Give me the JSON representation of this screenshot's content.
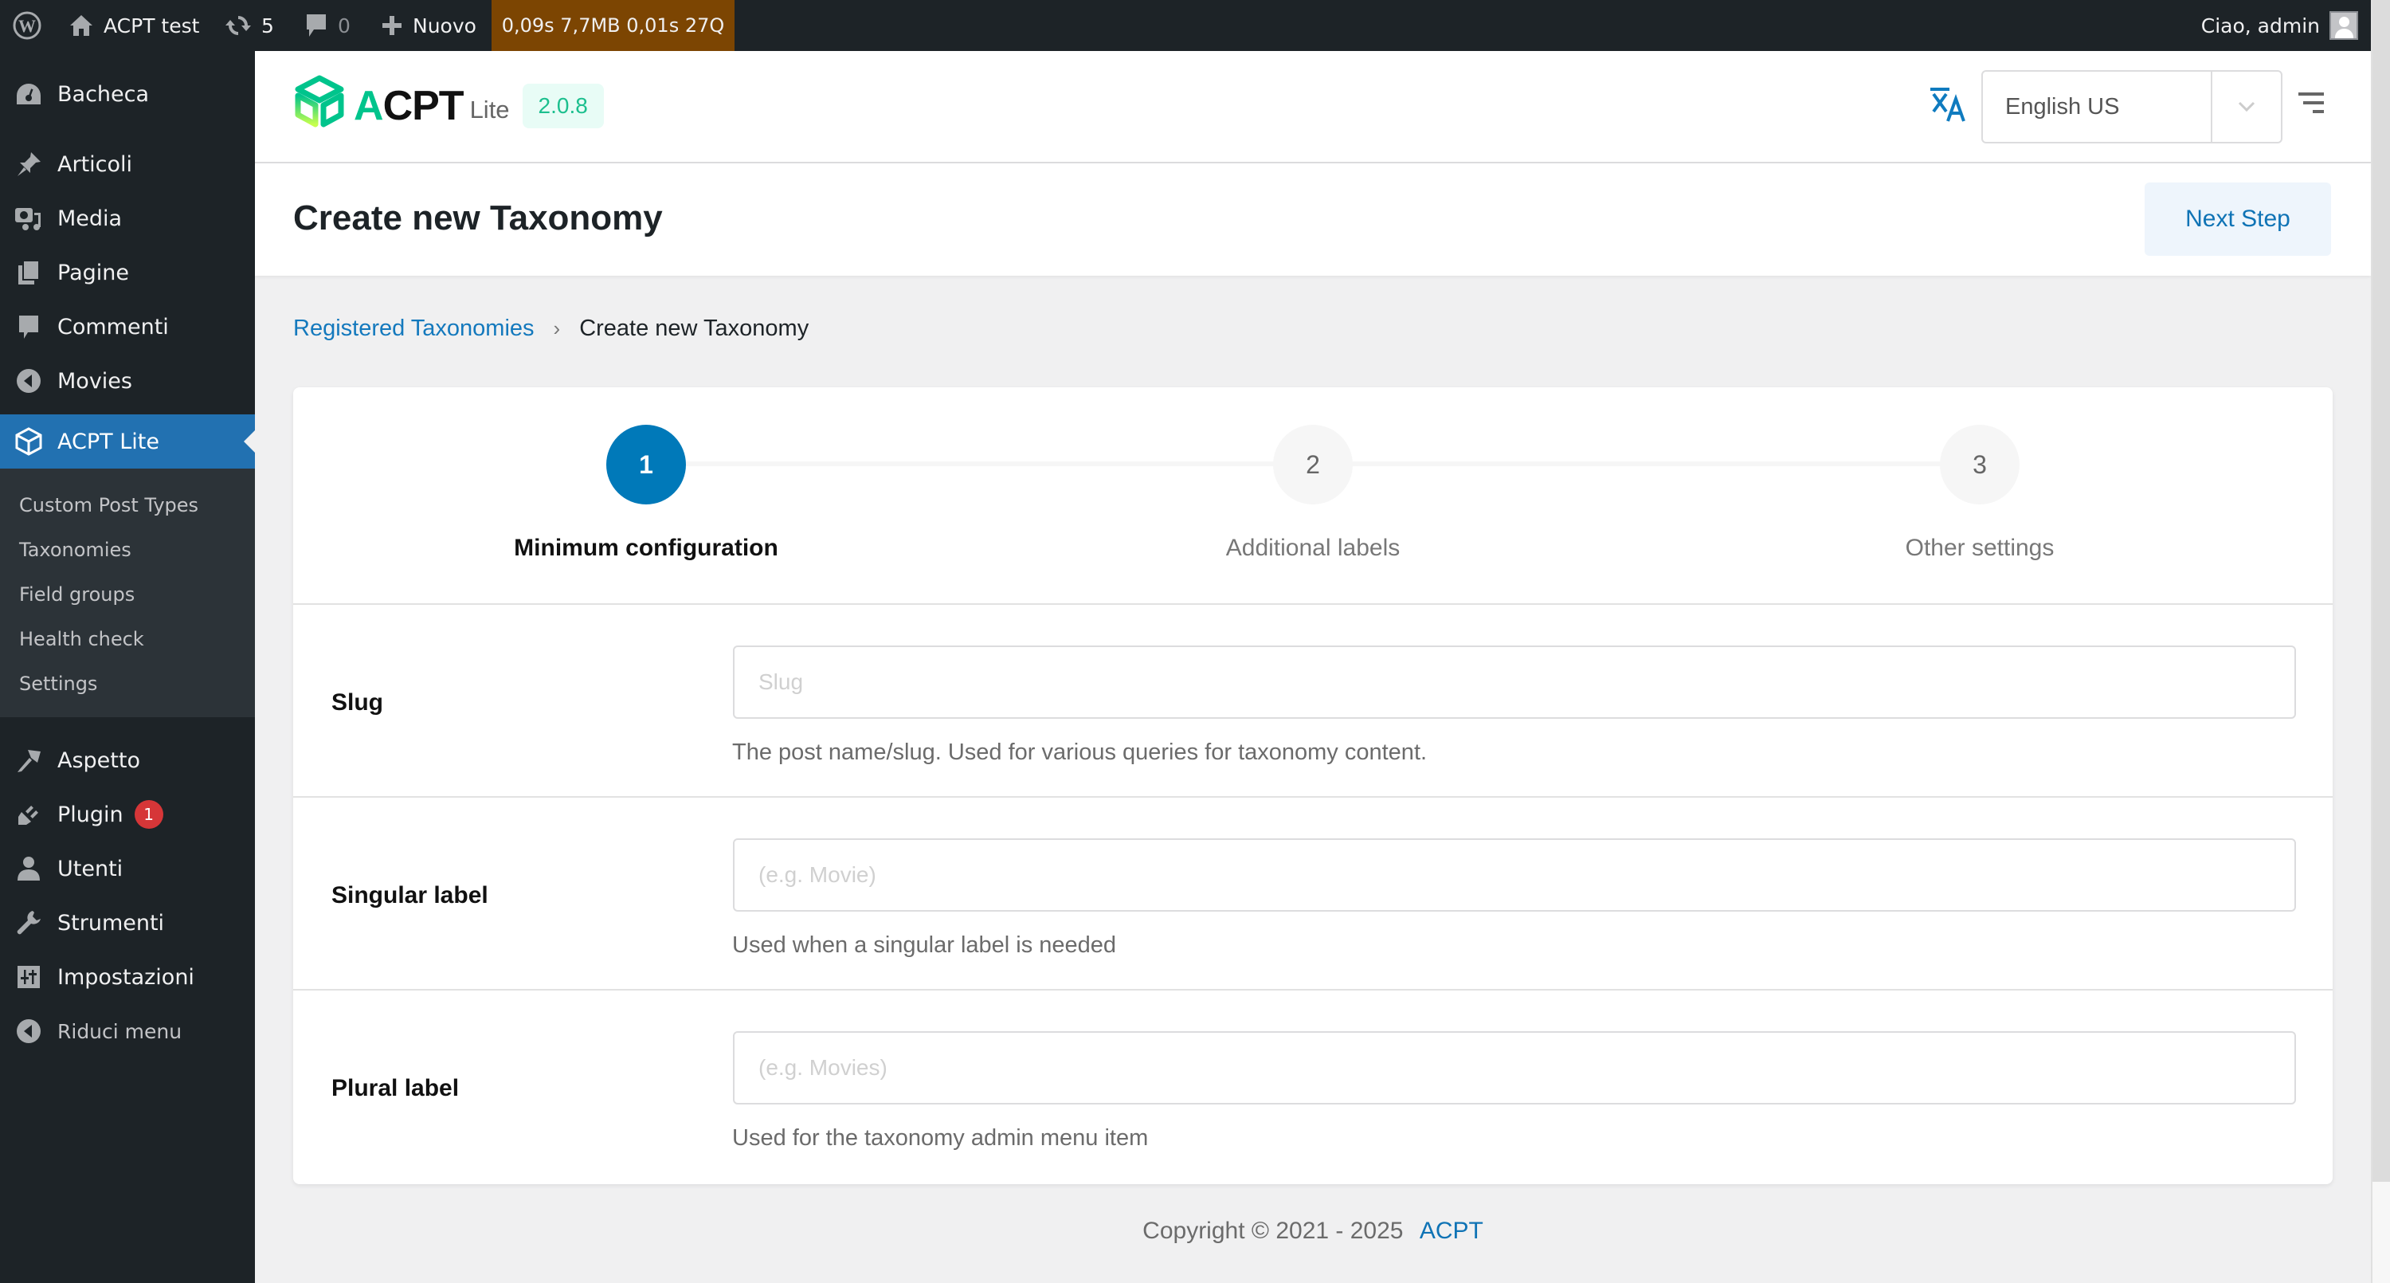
{
  "adminbar": {
    "site_name": "ACPT test",
    "updates_count": "5",
    "comments_count": "0",
    "new_label": "Nuovo",
    "perf": "0,09s  7,7MB  0,01s  27Q",
    "greeting": "Ciao, admin"
  },
  "sidebar": {
    "items": [
      {
        "label": "Bacheca",
        "icon": "dashboard-icon"
      },
      {
        "label": "Articoli",
        "icon": "pin-icon"
      },
      {
        "label": "Media",
        "icon": "media-icon"
      },
      {
        "label": "Pagine",
        "icon": "pages-icon"
      },
      {
        "label": "Commenti",
        "icon": "comments-icon"
      },
      {
        "label": "Movies",
        "icon": "movies-icon"
      },
      {
        "label": "ACPT Lite",
        "icon": "acpt-cube-icon",
        "active": true
      },
      {
        "label": "Aspetto",
        "icon": "brush-icon"
      },
      {
        "label": "Plugin",
        "icon": "plugin-icon",
        "badge": "1"
      },
      {
        "label": "Utenti",
        "icon": "users-icon"
      },
      {
        "label": "Strumenti",
        "icon": "wrench-icon"
      },
      {
        "label": "Impostazioni",
        "icon": "settings-icon"
      },
      {
        "label": "Riduci menu",
        "icon": "collapse-icon"
      }
    ],
    "submenu": [
      "Custom Post Types",
      "Taxonomies",
      "Field groups",
      "Health check",
      "Settings"
    ]
  },
  "header": {
    "logo_a": "A",
    "logo_rest": "CPT",
    "logo_lite": "Lite",
    "version": "2.0.8",
    "language": "English US"
  },
  "page": {
    "title": "Create new Taxonomy",
    "next_step": "Next Step"
  },
  "breadcrumb": {
    "parent": "Registered Taxonomies",
    "separator": "›",
    "current": "Create new Taxonomy"
  },
  "steps": [
    {
      "number": "1",
      "label": "Minimum configuration",
      "active": true
    },
    {
      "number": "2",
      "label": "Additional labels",
      "active": false
    },
    {
      "number": "3",
      "label": "Other settings",
      "active": false
    }
  ],
  "fields": [
    {
      "label": "Slug",
      "placeholder": "Slug",
      "value": "",
      "hint": "The post name/slug. Used for various queries for taxonomy content."
    },
    {
      "label": "Singular label",
      "placeholder": "(e.g. Movie)",
      "value": "",
      "hint": "Used when a singular label is needed"
    },
    {
      "label": "Plural label",
      "placeholder": "(e.g. Movies)",
      "value": "",
      "hint": "Used for the taxonomy admin menu item"
    }
  ],
  "footer": {
    "copyright": "Copyright © 2021 - 2025",
    "link": "ACPT"
  },
  "colors": {
    "wp_dark": "#1d2327",
    "wp_blue": "#2271b1",
    "acpt_green": "#00c48c",
    "primary": "#0079b9",
    "perf_bg": "#7c4502"
  }
}
